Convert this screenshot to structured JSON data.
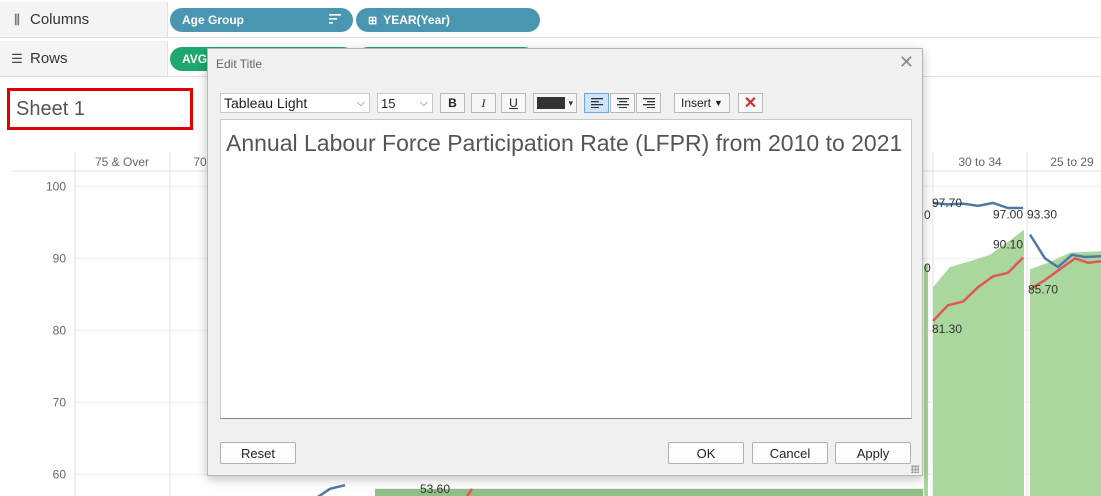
{
  "shelves": {
    "columns": {
      "icon": "columns-icon",
      "label": "Columns",
      "pills": [
        {
          "label": "Age Group",
          "color": "#4a96b0",
          "icon": "sort-icon"
        },
        {
          "label": "YEAR(Year)",
          "color": "#4a96b0",
          "icon": "expand-plus-icon"
        }
      ]
    },
    "rows": {
      "icon": "rows-icon",
      "label": "Rows",
      "pills": [
        {
          "label": "AVG",
          "color": "#1ea86e"
        }
      ]
    }
  },
  "sheet": {
    "title": "Sheet 1"
  },
  "chart_data": {
    "type": "line",
    "categories": [
      "75 & Over",
      "70",
      "30 to 34",
      "25 to 29"
    ],
    "y_ticks": [
      "100",
      "90",
      "80",
      "70",
      "60"
    ],
    "ylim": [
      57,
      102
    ],
    "grid": true,
    "colors": {
      "series_a": "#4e79a7",
      "series_b": "#e15759",
      "area": "#a9d79d"
    },
    "labels": [
      "97.70",
      "0",
      "97.00",
      "93.30",
      "90.10",
      "0",
      "85.70",
      "81.30",
      "53.60"
    ],
    "series": [
      {
        "values": [
          97.7,
          97.5,
          97.6,
          97.3,
          97.7,
          97.0,
          97.0
        ]
      },
      {
        "values": [
          81.3,
          83.5,
          84.0,
          86.0,
          87.5,
          88.0,
          90.1
        ]
      }
    ]
  },
  "dialog": {
    "title": "Edit Title",
    "close_icon": "close-icon",
    "font_family": "Tableau Light",
    "font_size": "15",
    "bold_label": "B",
    "italic_label": "I",
    "underline_label": "U",
    "text_color": "#333333",
    "insert_label": "Insert",
    "clear_icon": "clear-x-icon",
    "title_text": "Annual Labour Force Participation Rate (LFPR) from 2010 to 2021",
    "reset_label": "Reset",
    "ok_label": "OK",
    "cancel_label": "Cancel",
    "apply_label": "Apply"
  }
}
